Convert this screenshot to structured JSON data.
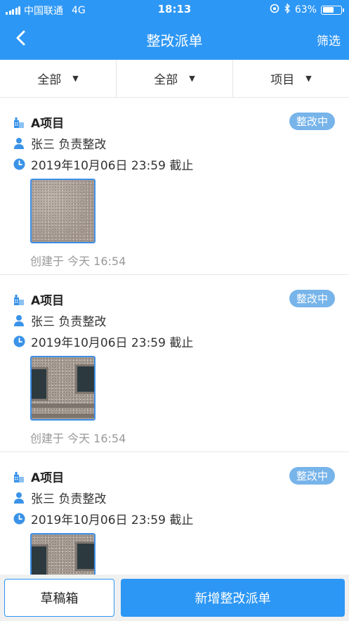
{
  "status_bar": {
    "carrier": "中国联通",
    "network": "4G",
    "time": "18:13",
    "battery": "63%",
    "battery_level": 0.63
  },
  "nav": {
    "title": "整改派单",
    "filter_label": "筛选"
  },
  "filters": [
    {
      "label": "全部"
    },
    {
      "label": "全部"
    },
    {
      "label": "项目"
    }
  ],
  "orders": [
    {
      "project": "A项目",
      "status": "整改中",
      "responsible": "张三 负责整改",
      "deadline": "2019年10月06日 23:59 截止",
      "created": "创建于 今天 16:54",
      "photo": "wall-texture"
    },
    {
      "project": "A项目",
      "status": "整改中",
      "responsible": "张三 负责整改",
      "deadline": "2019年10月06日 23:59 截止",
      "created": "创建于 今天 16:54",
      "photo": "building-facade"
    },
    {
      "project": "A项目",
      "status": "整改中",
      "responsible": "张三 负责整改",
      "deadline": "2019年10月06日 23:59 截止",
      "created": "",
      "photo": "building-facade"
    }
  ],
  "bottom": {
    "draft_label": "草稿箱",
    "new_label": "新增整改派单"
  },
  "colors": {
    "primary": "#2d97f5",
    "badge": "#77b4ea"
  }
}
